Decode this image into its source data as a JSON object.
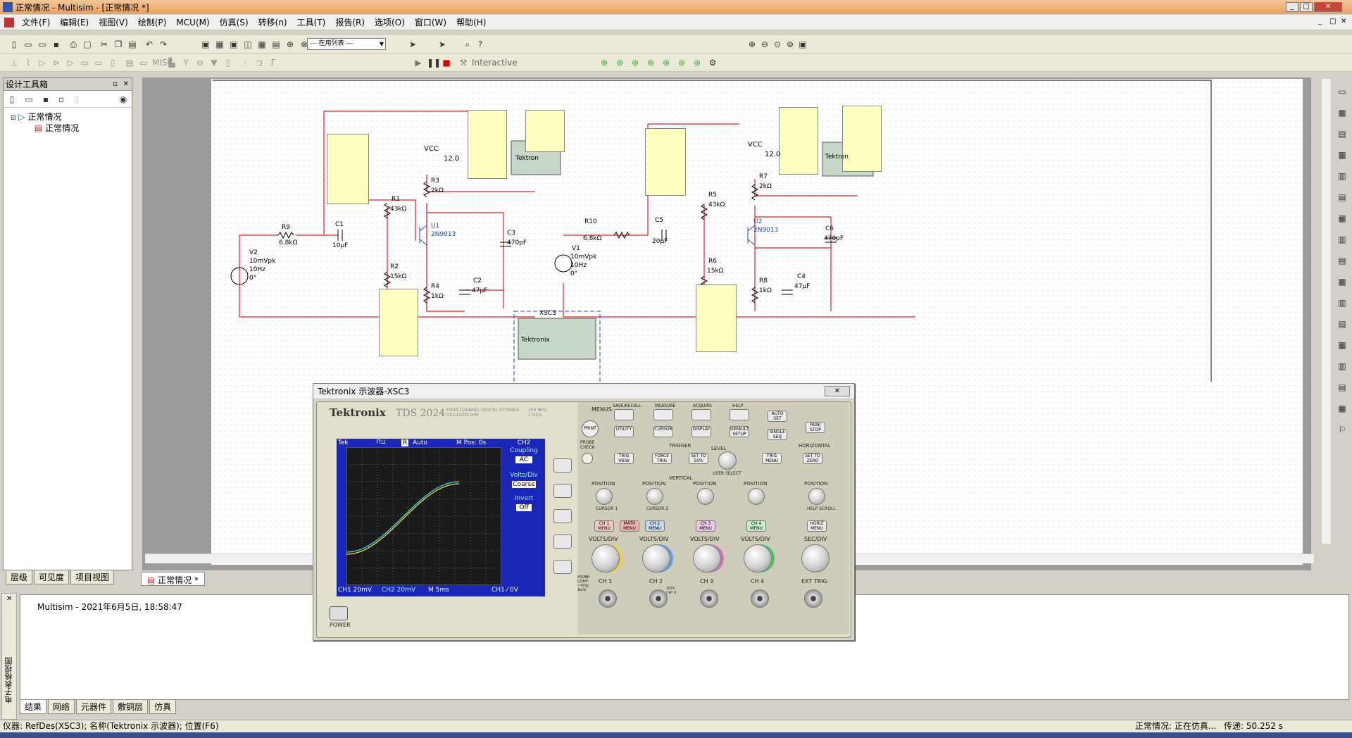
{
  "window": {
    "title": "正常情况 - Multisim - [正常情况 *]"
  },
  "menu": [
    "文件(F)",
    "编辑(E)",
    "视图(V)",
    "绘制(P)",
    "MCU(M)",
    "仿真(S)",
    "转移(n)",
    "工具(T)",
    "报告(R)",
    "选项(O)",
    "窗口(W)",
    "帮助(H)"
  ],
  "toolbar": {
    "in_use_list": "--- 在用列表 ---",
    "interactive": "Interactive"
  },
  "toolbox": {
    "title": "设计工具箱",
    "tree": [
      "正常情况",
      "正常情况"
    ],
    "tabs": [
      "层级",
      "可见度",
      "项目视图"
    ]
  },
  "doc_tab": "正常情况 *",
  "schematic": {
    "labels": {
      "vcc1": "VCC",
      "v12a": "12.0",
      "vcc2": "VCC",
      "v12b": "12.0",
      "r9": "R9",
      "r9v": "6.8kΩ",
      "c1": "C1",
      "c1v": "10µF",
      "r1": "R1",
      "r1v": "43kΩ",
      "r3": "R3",
      "r3v": "2kΩ",
      "u1": "U1",
      "u1v": "2N9013",
      "c3": "C3",
      "c3v": "470pF",
      "v2": "V2",
      "v2a": "10mVpk",
      "v2b": "10Hz",
      "v2c": "0°",
      "r2": "R2",
      "r2v": "15kΩ",
      "r4": "R4",
      "r4v": "1kΩ",
      "c2": "C2",
      "c2v": "47µF",
      "xsc3": "XSC3",
      "r10": "R10",
      "r10v": "6.8kΩ",
      "c5": "C5",
      "c5v": "20µF",
      "r5": "R5",
      "r5v": "43kΩ",
      "r7": "R7",
      "r7v": "2kΩ",
      "u2": "U2",
      "u2v": "2N9013",
      "c6": "C6",
      "c6v": "470pF",
      "v1": "V1",
      "v1a": "10mVpk",
      "v1b": "10Hz",
      "v1c": "0°",
      "r6": "R6",
      "r6v": "15kΩ",
      "r8": "R8",
      "r8v": "1kΩ",
      "c4": "C4",
      "c4v": "47µF",
      "tek1": "Tektron",
      "tek2": "Tektron",
      "tek3": "Tektronix"
    }
  },
  "scope": {
    "title": "Tektronix 示波器-XSC3",
    "brand": "Tektronix",
    "model": "TDS 2024",
    "model_sub": "FOUR CHANNEL DIGITAL STORAGE OSCILLOSCOPE",
    "spec": "200 MHz 2 GS/s",
    "screen_top": {
      "tek": "Tek",
      "trig": "R",
      "auto": "Auto",
      "mpos": "M Pos: 0s"
    },
    "menu": {
      "ch": "CH2",
      "coupling_l": "Coupling",
      "coupling_v": "AC",
      "voltsdiv_l": "Volts/Div",
      "voltsdiv_v": "Coarse",
      "invert_l": "Invert",
      "invert_v": "Off"
    },
    "screen_bottom": {
      "ch1": "CH1 20mV",
      "ch2": "CH2 20mV",
      "m": "M 5ms",
      "trig": "CH1 ⁄ 0V"
    },
    "buttons": {
      "menus": "MENUS",
      "save": "SAVE/RECALL",
      "measure": "MEASURE",
      "acquire": "ACQUIRE",
      "help": "HELP",
      "print": "PRINT",
      "utility": "UTILITY",
      "cursor": "CURSOR",
      "display": "DISPLAY",
      "default": "DEFAULT SETUP",
      "autoset": "AUTO SET",
      "single": "SINGLE SEQ",
      "runstop": "RUN/ STOP",
      "probecheck": "PROBE CHECK",
      "trigger": "TRIGGER",
      "level": "LEVEL",
      "trigview": "TRIG VIEW",
      "force": "FORCE TRIG",
      "set50": "SET TO 50%",
      "trigmenu": "TRIG MENU",
      "setzero": "SET TO ZERO",
      "horizontal": "HORIZONTAL",
      "vertical": "VERTICAL",
      "userselect": "USER SELECT",
      "position": "POSITION",
      "cursor1": "CURSOR 1",
      "cursor2": "CURSOR 2",
      "helpscroll": "HELP SCROLL",
      "ch1m": "CH 1 MENU",
      "mathm": "MATH MENU",
      "ch2m": "CH 2 MENU",
      "ch3m": "CH 3 MENU",
      "ch4m": "CH 4 MENU",
      "horizm": "HORIZ MENU",
      "voltsdiv": "VOLTS/DIV",
      "secdiv": "SEC/DIV",
      "ch1": "CH 1",
      "ch2": "CH 2",
      "ch3": "CH 3",
      "ch4": "CH 4",
      "exttrig": "EXT TRIG",
      "power": "POWER",
      "probecomp": "PROBE COMP ~5V@ 1kHz",
      "cat": "300V CAT II"
    }
  },
  "output": {
    "line": "Multisim  -  2021年6月5日, 18:58:47",
    "side": "电子表格视图",
    "tabs": [
      "结果",
      "网络",
      "元器件",
      "敷铜层",
      "仿真"
    ]
  },
  "status": {
    "left": "仪器: RefDes(XSC3); 名称(Tektronix 示波器); 位置(F6)",
    "right1": "正常情况: 正在仿真...",
    "right2": "传递: 50.252 s"
  },
  "colors": {
    "wire": "#e02020",
    "trace1": "#f0e040",
    "trace2": "#40d0e0",
    "screen": "#1a26b8"
  }
}
